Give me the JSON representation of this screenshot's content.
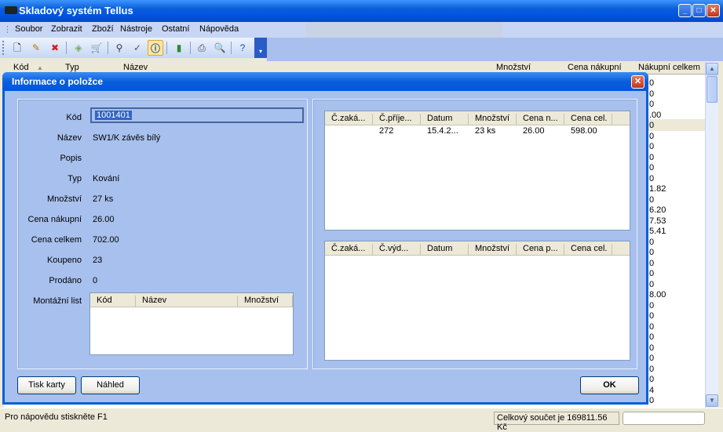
{
  "app": {
    "title": "Skladový systém Tellus"
  },
  "menu": [
    "Soubor",
    "Zobrazit",
    "Zboží",
    "Nástroje",
    "Ostatní",
    "Nápověda"
  ],
  "toolbar": {
    "icons": [
      "new-icon",
      "edit-icon",
      "delete-icon",
      "tag-icon",
      "cart-icon",
      "find-icon",
      "filter-icon",
      "info-icon",
      "book-icon",
      "print-icon",
      "preview-icon",
      "help-icon",
      "overflow-icon"
    ]
  },
  "list": {
    "headers": [
      "Kód",
      "Typ",
      "Název",
      "Množství",
      "Cena nákupní",
      "Nákupní celkem"
    ],
    "col_values": [
      "0",
      "0",
      "0",
      ".00",
      "0",
      "0",
      "0",
      "0",
      "0",
      "0",
      "1.82",
      "0",
      "6.20",
      "7.53",
      "5.41",
      "0",
      "0",
      "0",
      "0",
      "0",
      "8.00",
      "0",
      "0",
      "0",
      "0",
      "0",
      "0",
      "0",
      "0",
      "4",
      "0"
    ]
  },
  "status": {
    "help": "Pro nápovědu stiskněte F1",
    "total": "Celkový součet je 169811.56 Kč"
  },
  "dialog": {
    "title": "Informace o položce",
    "close_glyph": "✕",
    "fields": {
      "kod_label": "Kód",
      "kod_value": "1001401",
      "nazev_label": "Název",
      "nazev_value": "SW1/K závěs bílý",
      "popis_label": "Popis",
      "popis_value": "",
      "typ_label": "Typ",
      "typ_value": "Kování",
      "mnozstvi_label": "Množství",
      "mnozstvi_value": "27 ks",
      "cena_nakupni_label": "Cena nákupní",
      "cena_nakupni_value": "26.00",
      "cena_celkem_label": "Cena celkem",
      "cena_celkem_value": "702.00",
      "koupeno_label": "Koupeno",
      "koupeno_value": "23",
      "prodano_label": "Prodáno",
      "prodano_value": "0",
      "montazni_label": "Montážní list"
    },
    "montazni_grid": {
      "headers": [
        "Kód",
        "Název",
        "Množství"
      ]
    },
    "prijem_grid": {
      "headers": [
        "Č.zaká...",
        "Č.příje...",
        "Datum",
        "Množství",
        "Cena n...",
        "Cena cel."
      ],
      "rows": [
        [
          "",
          "272",
          "15.4.2...",
          "23 ks",
          "26.00",
          "598.00"
        ]
      ]
    },
    "vydej_grid": {
      "headers": [
        "Č.zaká...",
        "Č.výd...",
        "Datum",
        "Množství",
        "Cena p...",
        "Cena cel."
      ]
    },
    "buttons": {
      "print": "Tisk karty",
      "preview": "Náhled",
      "ok": "OK"
    }
  }
}
